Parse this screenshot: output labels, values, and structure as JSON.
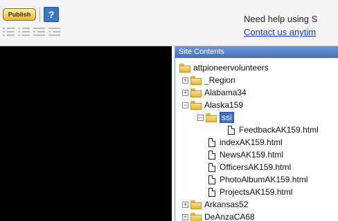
{
  "toolbar": {
    "publish_label": "Publish",
    "help_label": "?",
    "format_icons": [
      "numbered-list-icon",
      "bulleted-list-icon",
      "outdent-icon",
      "indent-icon"
    ]
  },
  "help": {
    "text": "Need help using S",
    "link": "Contact us anytim"
  },
  "panel": {
    "title": "Site Contents",
    "tree": {
      "root": "attpioneervolunteers",
      "region": "_Region",
      "alabama": "Alabama34",
      "alaska": "Alaska159",
      "ssi": "ssi",
      "feedback": "FeedbackAK159.html",
      "index": "indexAK159.html",
      "news": "NewsAK159.html",
      "officers": "OfficersAK159.html",
      "photo": "PhotoAlbumAK159.html",
      "projects": "ProjectsAK159.html",
      "arkansas": "Arkansas52",
      "deanza": "DeAnzaCA68"
    }
  },
  "colors": {
    "panel_header": "#4a6fb6",
    "selection": "#3d6fc7",
    "link": "#1a3cc7",
    "folder": "#e6b43a"
  }
}
